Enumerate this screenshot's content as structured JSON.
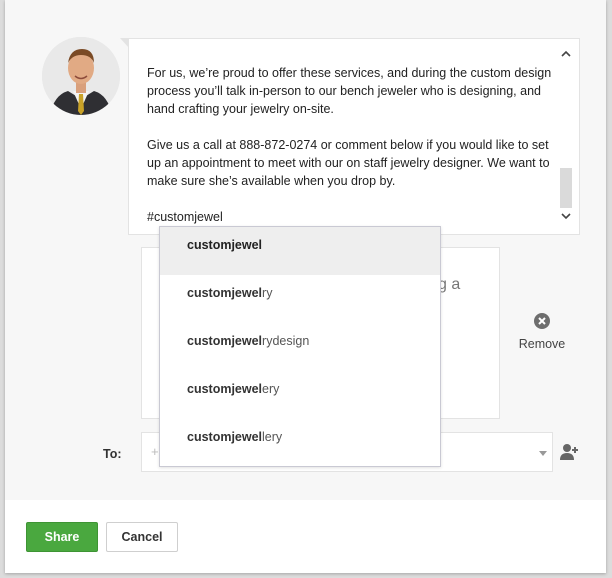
{
  "post": {
    "paragraphs": [
      "For us, we’re proud to offer these services, and during the custom design process you’ll talk in-person to our bench jeweler who is designing, and hand crafting your jewelry on-site.",
      "Give us a call at 888-872-0274 or comment below if you would like to set up an appointment to meet with our on staff jewelry designer. We want to make sure she’s available when you drop by."
    ],
    "hashtag": "#customjewel"
  },
  "preview": {
    "visible_fragment": "g a"
  },
  "remove": {
    "label": "Remove",
    "icon": "close-circle-icon"
  },
  "to": {
    "label": "To:",
    "placeholder_glyph": "+",
    "add_icon": "add-person-icon"
  },
  "suggestions": {
    "query": "customjewel",
    "items": [
      {
        "match": "customjewel",
        "rest": "",
        "active": true
      },
      {
        "match": "customjewel",
        "rest": "ry",
        "active": false
      },
      {
        "match": "customjewel",
        "rest": "rydesign",
        "active": false
      },
      {
        "match": "customjewel",
        "rest": "ery",
        "active": false
      },
      {
        "match": "customjewel",
        "rest": "lery",
        "active": false
      }
    ]
  },
  "footer": {
    "share_label": "Share",
    "cancel_label": "Cancel"
  },
  "colors": {
    "share_green": "#4aa83f",
    "dialog_bg": "#f7f7f7"
  }
}
